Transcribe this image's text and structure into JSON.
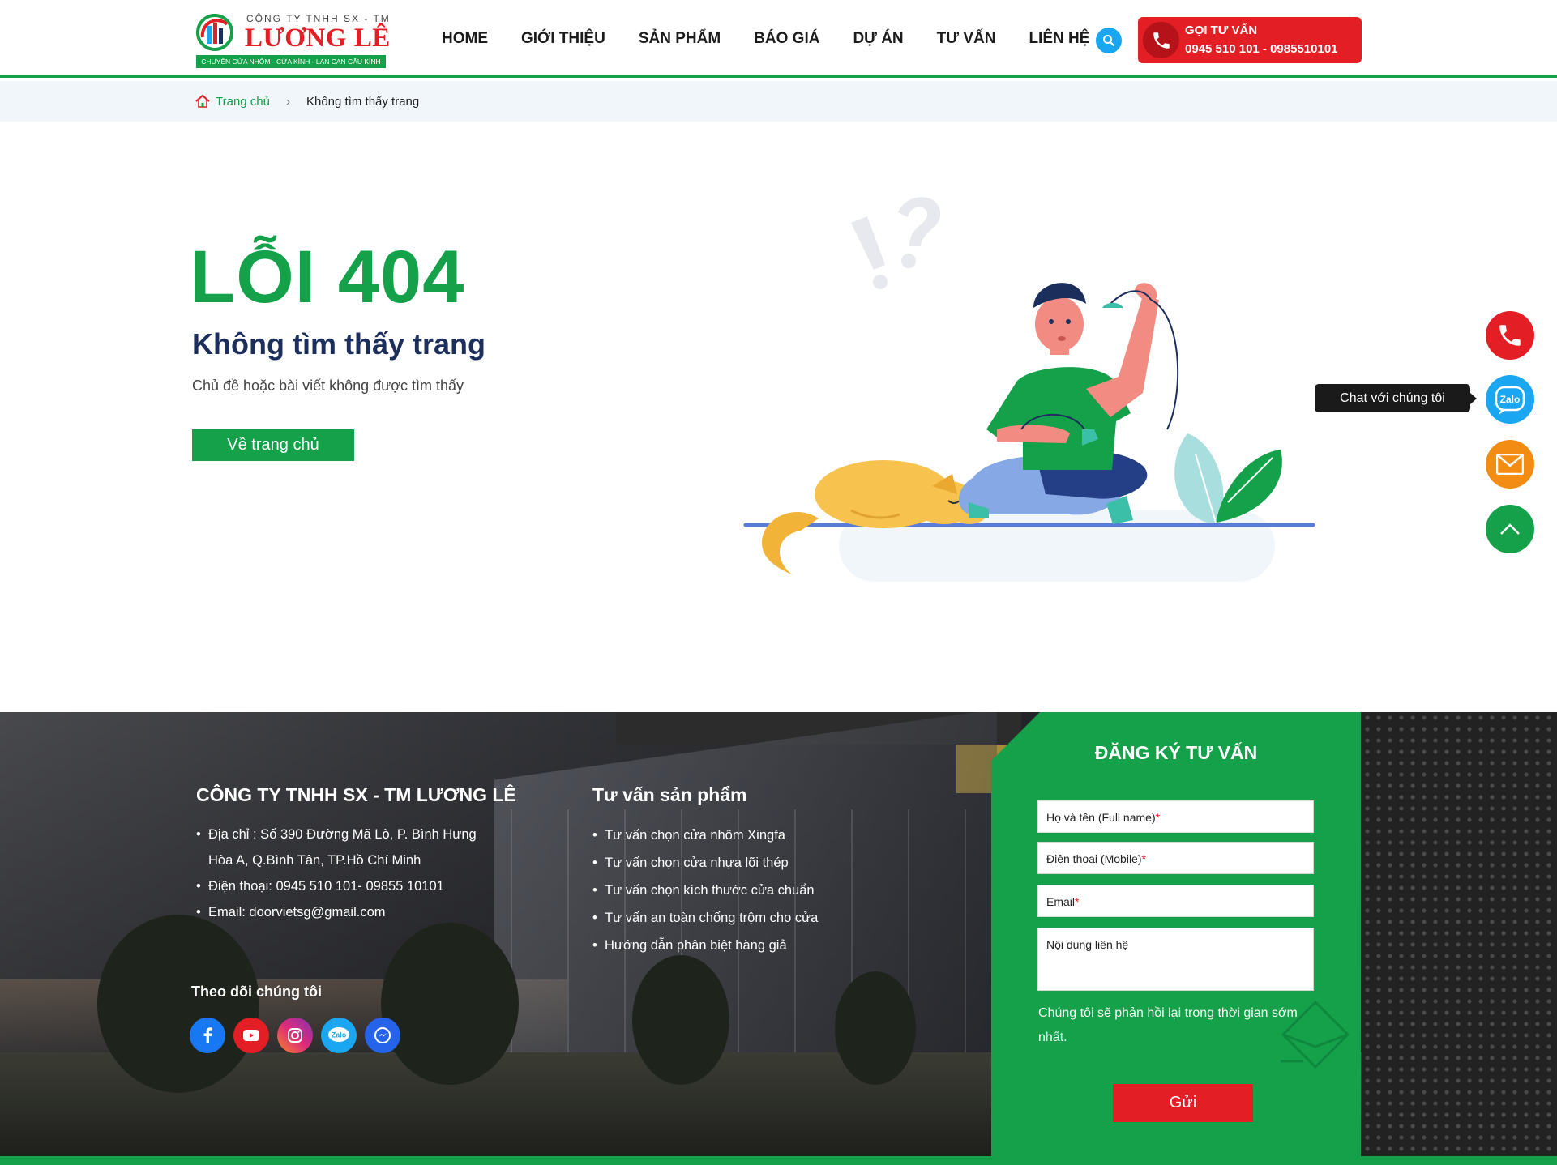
{
  "header": {
    "logo": {
      "top_text": "CÔNG TY TNHH SX - TM",
      "name": "LƯƠNG LÊ",
      "tagline": "CHUYÊN CỬA NHÔM - CỬA KÍNH - LAN CAN CẦU KÍNH"
    },
    "nav": [
      "HOME",
      "GIỚI THIỆU",
      "SẢN PHẨM",
      "BÁO GIÁ",
      "DỰ ÁN",
      "TƯ VẤN",
      "LIÊN HỆ"
    ],
    "call": {
      "title": "GỌI TƯ VẤN",
      "phones": "0945 510 101 - 0985510101"
    }
  },
  "breadcrumb": {
    "home": "Trang chủ",
    "current": "Không tìm thấy trang"
  },
  "error": {
    "title": "LỖI 404",
    "subtitle": "Không tìm thấy trang",
    "description": "Chủ đề hoặc bài viết không được tìm thấy",
    "button": "Về trang chủ"
  },
  "floating": {
    "chat_tooltip": "Chat với chúng tôi",
    "zalo_label": "Zalo"
  },
  "footer": {
    "company": {
      "title": "CÔNG TY TNHH SX - TM LƯƠNG LÊ",
      "address_line1": " Địa chỉ : Số 390 Đường Mã Lò, P. Bình Hưng",
      "address_line2": "Hòa A, Q.Bình Tân, TP.Hồ Chí Minh",
      "phone": "Điện thoại: 0945 510 101- 09855 10101",
      "email": "Email: doorvietsg@gmail.com"
    },
    "consult": {
      "title": "Tư vấn sản phẩm",
      "items": [
        "Tư vấn chọn cửa nhôm Xingfa",
        "Tư vấn chọn cửa nhựa lõi thép",
        "Tư vấn chọn kích thước cửa chuẩn",
        "Tư vấn an toàn chống trộm cho cửa",
        "Hướng dẫn phân biệt hàng giả"
      ]
    },
    "follow": {
      "title": "Theo dõi chúng tôi",
      "zalo_label": "Zalo"
    },
    "form": {
      "title": "ĐĂNG KÝ TƯ VẤN",
      "name_placeholder": "Họ và tên (Full name)",
      "phone_placeholder": "Điện thoại (Mobile)",
      "email_placeholder": "Email",
      "message_placeholder": "Nội dung liên hệ",
      "required_mark": "*",
      "note": "Chúng tôi sẽ phản hồi lại trong thời gian sớm nhất.",
      "submit": "Gửi"
    }
  },
  "colors": {
    "brand_green": "#14a14a",
    "brand_red": "#e31e24",
    "navy": "#1c2f5c",
    "sky": "#1aa6f0",
    "orange": "#f28c13"
  }
}
